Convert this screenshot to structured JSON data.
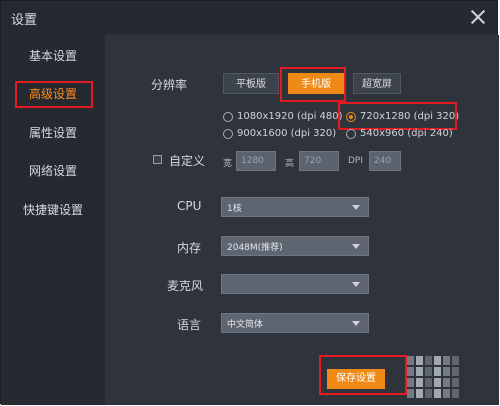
{
  "window": {
    "title": "设置"
  },
  "sidebar": {
    "items": [
      {
        "label": "基本设置"
      },
      {
        "label": "高级设置"
      },
      {
        "label": "属性设置"
      },
      {
        "label": "网络设置"
      },
      {
        "label": "快捷键设置"
      }
    ]
  },
  "resolution": {
    "label": "分辨率",
    "tabs": [
      "平板版",
      "手机版",
      "超宽屏"
    ],
    "selected_tab": "手机版",
    "options": [
      {
        "label": "1080x1920 (dpi 480)",
        "checked": false
      },
      {
        "label": "720x1280 (dpi 320)",
        "checked": true
      },
      {
        "label": "900x1600 (dpi 320)",
        "checked": false
      },
      {
        "label": "540x960 (dpi 240)",
        "checked": false
      }
    ]
  },
  "custom": {
    "label": "自定义",
    "width_label": "宽",
    "width_value": "1280",
    "height_label": "高",
    "height_value": "720",
    "dpi_label": "DPI",
    "dpi_value": "240"
  },
  "cpu": {
    "label": "CPU",
    "value": "1核"
  },
  "memory": {
    "label": "内存",
    "value": "2048M(推荐)"
  },
  "mic": {
    "label": "麦克风",
    "value": ""
  },
  "language": {
    "label": "语言",
    "value": "中文简体"
  },
  "save_button": {
    "label": "保存设置"
  }
}
